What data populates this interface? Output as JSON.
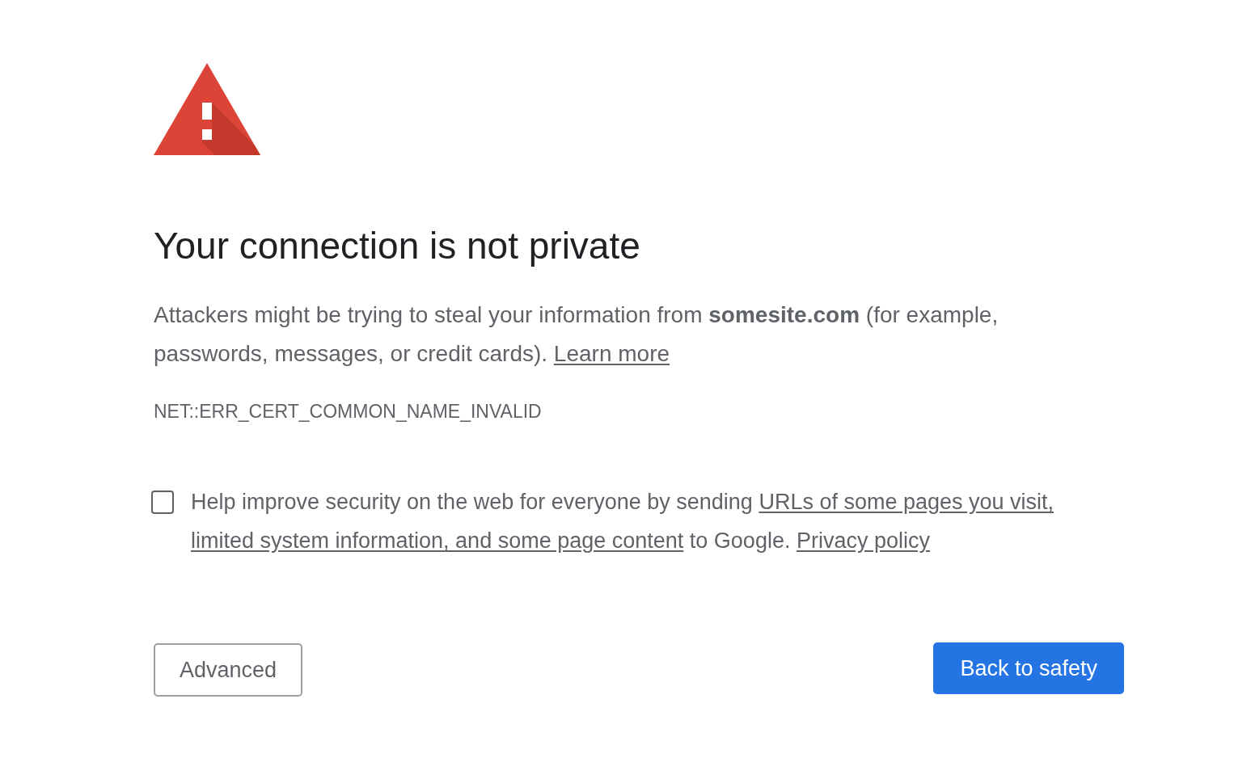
{
  "heading": "Your connection is not private",
  "explanation": {
    "text": "Attackers might be trying to steal your information from **somesite.com** (for example, passwords, messages, or credit cards).",
    "link": "Learn more"
  },
  "error_code": "NET::ERR_CERT_COMMON_NAME_INVALID",
  "opt_in": {
    "checked": false,
    "parts": [
      {
        "kind": "text",
        "text": "Help improve security on the web for everyone by sending"
      },
      {
        "kind": "link",
        "text": "URLs of some pages you visit,"
      },
      {
        "kind": "link",
        "text": "limited system information, and some page content"
      },
      {
        "kind": "text",
        "text": "to Google."
      },
      {
        "kind": "link",
        "text": "Privacy policy"
      }
    ]
  },
  "buttons": [
    {
      "label": "Advanced",
      "kind": "secondary"
    },
    {
      "label": "Back to safety",
      "kind": "primary"
    }
  ]
}
